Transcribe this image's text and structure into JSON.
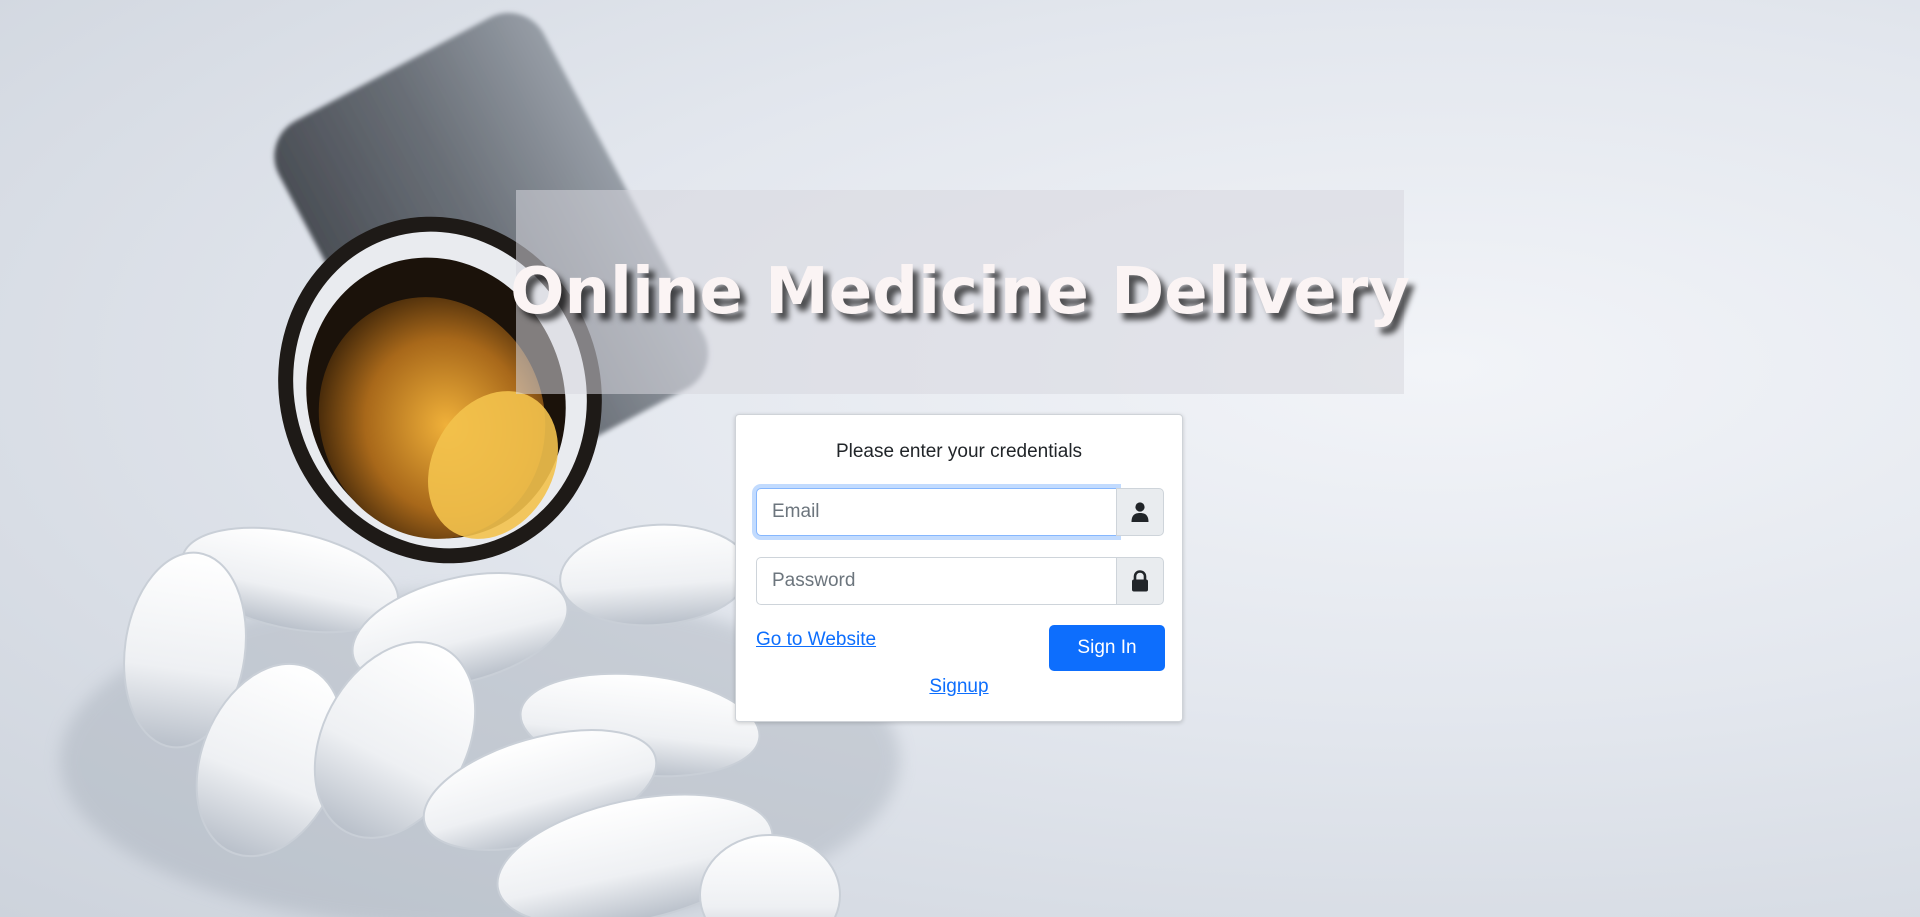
{
  "banner": {
    "title": "Online Medicine Delivery"
  },
  "login": {
    "heading": "Please enter your credentials",
    "email": {
      "placeholder": "Email",
      "value": ""
    },
    "password": {
      "placeholder": "Password",
      "value": ""
    },
    "website_link": "Go to Website",
    "signin_label": "Sign In",
    "signup_link": "Signup"
  },
  "icons": {
    "email_addon": "user-icon",
    "password_addon": "lock-icon"
  },
  "colors": {
    "primary": "#0d6efd",
    "title_text": "#fbf4f4",
    "addon_bg": "#e9ecef"
  }
}
